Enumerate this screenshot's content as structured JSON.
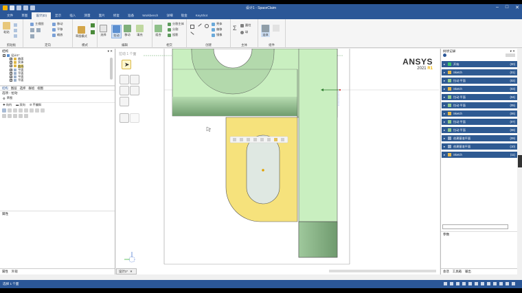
{
  "window": {
    "title": "设计1 - SpaceClaim"
  },
  "tabs": [
    "文件",
    "草图",
    "设计(D)",
    "显示",
    "插入",
    "测量",
    "面片",
    "修复",
    "准备",
    "Workbench",
    "详细",
    "钣金",
    "KeyShot"
  ],
  "active_tab_index": 2,
  "ribbon": {
    "groups": {
      "clipboard": "剪贴板",
      "orient": "定向",
      "mode": "模式",
      "edit": "编辑",
      "intersect": "相交",
      "create": "创建",
      "body": "主体",
      "assembly": "组件"
    },
    "buttons": {
      "paste": "粘贴",
      "home": "主视图",
      "move_view": "移动",
      "pan": "平移",
      "zoom": "缩放",
      "sketch_mode": "草图模式",
      "select": "选择",
      "pull": "拉动",
      "move": "移动",
      "fill": "填充",
      "combine": "组合",
      "split_body": "分割主体",
      "split": "分割",
      "project": "投影",
      "shell": "壳体",
      "offset": "偏移",
      "mirror": "镜像",
      "equation": "方程",
      "cylinder": "圆柱",
      "sphere": "球",
      "merge": "连体"
    }
  },
  "structure": {
    "title": "结构",
    "items": [
      {
        "label": "设计1*",
        "checked": true,
        "level": 0
      },
      {
        "label": "曲面",
        "checked": true,
        "level": 1
      },
      {
        "label": "实体",
        "checked": true,
        "level": 1
      },
      {
        "label": "曲线",
        "checked": true,
        "level": 1
      },
      {
        "label": "平面",
        "checked": false,
        "level": 1
      },
      {
        "label": "平面",
        "checked": false,
        "level": 1
      },
      {
        "label": "平面",
        "checked": false,
        "level": 1
      },
      {
        "label": "平面",
        "checked": false,
        "level": 1
      }
    ]
  },
  "left_subtabs": [
    "结构",
    "图层",
    "选择",
    "群组",
    "视图"
  ],
  "options": {
    "title": "选项 - 拉动",
    "mode_label": "草图",
    "row1": [
      "向内",
      "双向",
      "不偏斜"
    ],
    "property_title": "属性",
    "bottom_tabs": [
      "属性",
      "外观"
    ]
  },
  "viewport": {
    "label": "拉动 1 个面",
    "logo_top": "ANSYS",
    "logo_year": "2021",
    "logo_rel": "R1",
    "doc_tab": "设计1*"
  },
  "history": {
    "title": "树状记录",
    "rows": [
      {
        "label": "开始",
        "num": "(00)"
      },
      {
        "label": "Sketch",
        "num": "(01)"
      },
      {
        "label": "拉动 平面",
        "num": "(02)"
      },
      {
        "label": "Sketch",
        "num": "(03)"
      },
      {
        "label": "拉动 平面",
        "num": "(04)"
      },
      {
        "label": "拉动 平面",
        "num": "(05)"
      },
      {
        "label": "Sketch",
        "num": "(06)"
      },
      {
        "label": "拉动 平面",
        "num": "(07)"
      },
      {
        "label": "拉动 平面",
        "num": "(08)"
      },
      {
        "label": "创建基准平面",
        "num": "(09)"
      },
      {
        "label": "创建基准平面",
        "num": "(10)"
      },
      {
        "label": "Sketch",
        "num": "(11)"
      }
    ],
    "params_title": "参数",
    "bottom_tabs": [
      "会话",
      "工具箱",
      "输出"
    ]
  },
  "status": {
    "message": "选择 1 个面"
  },
  "colors": {
    "green_body": "#c9efc0",
    "green_dark": "#7cab7a",
    "yellow_face": "#f6e27c",
    "hole_fill": "#dfe8e2",
    "history_row": "#2e5a92",
    "accent": "#2b5797"
  }
}
